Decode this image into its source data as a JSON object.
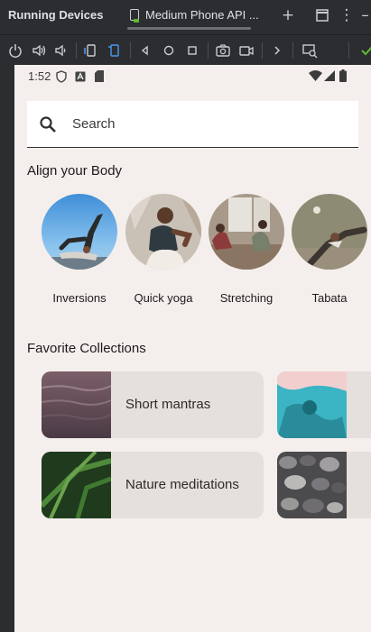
{
  "ide": {
    "panel_title": "Running Devices",
    "device_tab": "Medium Phone API ...",
    "colors": {
      "background": "#2b2d30",
      "text": "#dfe1e5"
    },
    "toolbar_icons": [
      "power-icon",
      "volume-up-icon",
      "volume-down-icon",
      "rotate-left-icon",
      "rotate-right-icon",
      "back-icon",
      "home-icon",
      "overview-icon",
      "screenshot-icon",
      "screen-record-icon",
      "more-icon",
      "device-mirror-icon",
      "check-icon"
    ]
  },
  "device": {
    "status_bar": {
      "time": "1:52"
    },
    "search": {
      "placeholder": "Search"
    },
    "align_body": {
      "title": "Align your Body",
      "items": [
        {
          "label": "Inversions"
        },
        {
          "label": "Quick yoga"
        },
        {
          "label": "Stretching"
        },
        {
          "label": "Tabata"
        }
      ]
    },
    "favorites": {
      "title": "Favorite Collections",
      "items": [
        {
          "label": "Short mantras"
        },
        {
          "label": "Nature meditations"
        }
      ]
    },
    "colors": {
      "background": "#f4efec",
      "card": "#e6e0dc",
      "search_bg": "#ffffff"
    }
  }
}
